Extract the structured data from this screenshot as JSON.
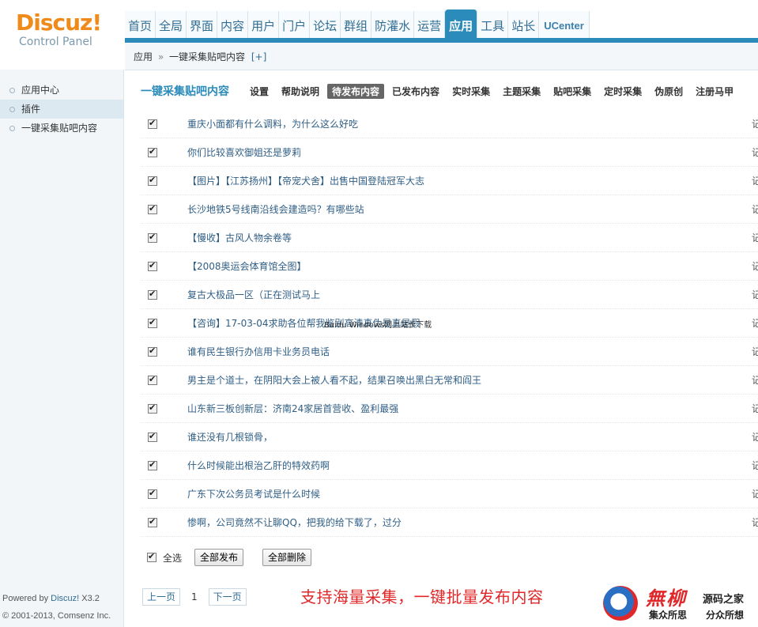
{
  "brand": {
    "name": "Discuz",
    "bang": "!",
    "subtitle": "Control Panel"
  },
  "topnav": {
    "items": [
      "首页",
      "全局",
      "界面",
      "内容",
      "用户",
      "门户",
      "论坛",
      "群组",
      "防灌水",
      "运营",
      "应用",
      "工具",
      "站长",
      "UCenter"
    ],
    "active": "应用"
  },
  "breadcrumb": {
    "root": "应用",
    "sep": "»",
    "current": "一键采集贴吧内容",
    "add": "[+]"
  },
  "sidebar": {
    "items": [
      "应用中心",
      "插件",
      "一键采集贴吧内容"
    ],
    "active_index": 1,
    "powered_prefix": "Powered by ",
    "powered_link": "Discuz!",
    "powered_version": " X3.2",
    "copyright": "© 2001-2013, Comsenz Inc."
  },
  "plugin": {
    "title": "一键采集贴吧内容",
    "tabs": [
      "设置",
      "帮助说明",
      "待发布内容",
      "已发布内容",
      "实时采集",
      "主题采集",
      "贴吧采集",
      "定时采集",
      "伪原创",
      "注册马甲"
    ],
    "active_tab": "待发布内容"
  },
  "posts": [
    {
      "title": "重庆小面都有什么调料，为什么这么好吃",
      "checked": true
    },
    {
      "title": "你们比较喜欢御姐还是萝莉",
      "checked": true
    },
    {
      "title": "【图片】【江苏扬州】【帝宠犬舍】出售中国登陆冠军大志",
      "checked": true
    },
    {
      "title": "长沙地铁5号线南沿线会建造吗？有哪些站",
      "checked": true
    },
    {
      "title": "【慢收】古风人物余卷等",
      "checked": true
    },
    {
      "title": "【2008奥运会体育馆全图】",
      "checked": true
    },
    {
      "title": "复古大极品一区（正在测试马上",
      "checked": true
    },
    {
      "title": "【咨询】17-03-04求助各位帮我鉴别高清真伪是真是假",
      "checked": true
    },
    {
      "title": "谁有民生银行办信用卡业务员电话",
      "checked": true
    },
    {
      "title": "男主是个道士，在阴阳大会上被人看不起，结果召唤出黑白无常和阎王",
      "checked": true
    },
    {
      "title": "山东新三板创新层：济南24家居首营收、盈利最强",
      "checked": true
    },
    {
      "title": "谁还没有几根锁骨，",
      "checked": true
    },
    {
      "title": "什么时候能出根治乙肝的特效药啊",
      "checked": true
    },
    {
      "title": "广东下次公务员考试是什么时候",
      "checked": true
    },
    {
      "title": "惨啊，公司竟然不让聊QQ，把我的给下载了，过分",
      "checked": true
    }
  ],
  "row_edge_char": "记",
  "overlay_text": "Baidu Windows网上站长下载",
  "actions": {
    "select_all_label": "全选",
    "publish_all": "全部发布",
    "delete_all": "全部删除"
  },
  "pager": {
    "prev": "上一页",
    "current": "1",
    "next": "下一页"
  },
  "promo_text": "支持海量采集，一键批量发布内容",
  "watermark": {
    "big": "無柳",
    "site": "源码之家",
    "left": "集众所思",
    "right": "分众所想"
  },
  "colors": {
    "accent": "#2b8bba",
    "brand_orange": "#f08a1a",
    "link": "#2f5e85",
    "promo_red": "#e0282a"
  }
}
